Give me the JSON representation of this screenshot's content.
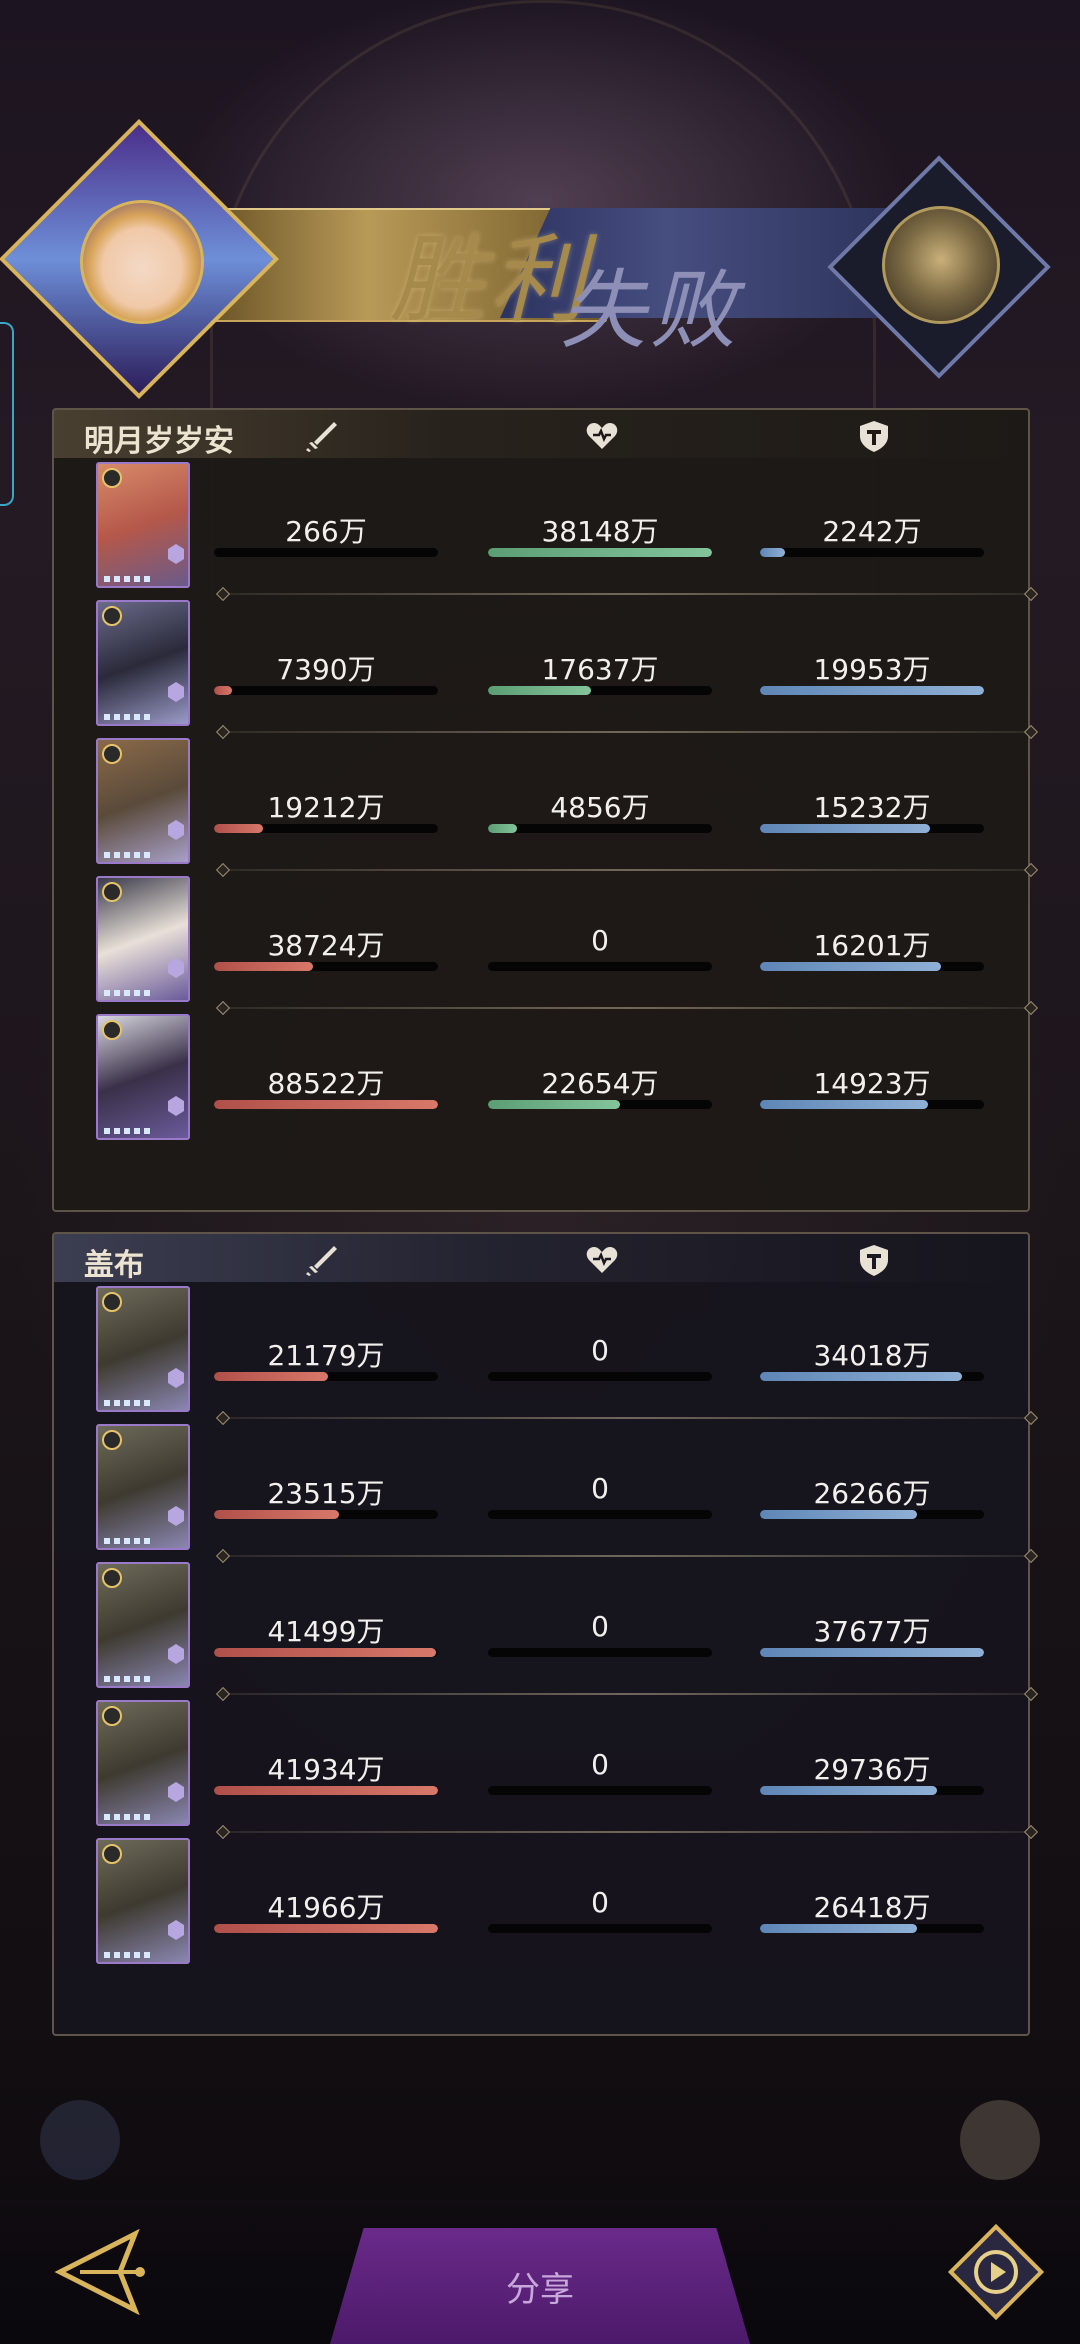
{
  "banner": {
    "victory_label": "胜利",
    "defeat_label": "失败",
    "left_avatar": "chibi-hero-avatar",
    "right_avatar": "armored-knight-avatar"
  },
  "colors": {
    "damage": "#d8786a",
    "healing": "#84c49a",
    "damage_taken": "#8fb0d6",
    "gold_accent": "#d8b45c",
    "defeat_accent": "#464e80"
  },
  "icons": {
    "damage": "sword-icon",
    "healing": "heart-icon",
    "damage_taken": "shield-icon"
  },
  "team_victory": {
    "name": "明月岁岁安",
    "heroes": [
      {
        "damage": "266万",
        "damage_pct": 0.0,
        "heal": "38148万",
        "heal_pct": 1.0,
        "taken": "2242万",
        "taken_pct": 0.11
      },
      {
        "damage": "7390万",
        "damage_pct": 0.08,
        "heal": "17637万",
        "heal_pct": 0.46,
        "taken": "19953万",
        "taken_pct": 1.0
      },
      {
        "damage": "19212万",
        "damage_pct": 0.22,
        "heal": "4856万",
        "heal_pct": 0.13,
        "taken": "15232万",
        "taken_pct": 0.76
      },
      {
        "damage": "38724万",
        "damage_pct": 0.44,
        "heal": "0",
        "heal_pct": 0.0,
        "taken": "16201万",
        "taken_pct": 0.81
      },
      {
        "damage": "88522万",
        "damage_pct": 1.0,
        "heal": "22654万",
        "heal_pct": 0.59,
        "taken": "14923万",
        "taken_pct": 0.75
      }
    ]
  },
  "team_defeat": {
    "name": "盖布",
    "heroes": [
      {
        "damage": "21179万",
        "damage_pct": 0.51,
        "heal": "0",
        "heal_pct": 0.0,
        "taken": "34018万",
        "taken_pct": 0.9
      },
      {
        "damage": "23515万",
        "damage_pct": 0.56,
        "heal": "0",
        "heal_pct": 0.0,
        "taken": "26266万",
        "taken_pct": 0.7
      },
      {
        "damage": "41499万",
        "damage_pct": 0.99,
        "heal": "0",
        "heal_pct": 0.0,
        "taken": "37677万",
        "taken_pct": 1.0
      },
      {
        "damage": "41934万",
        "damage_pct": 1.0,
        "heal": "0",
        "heal_pct": 0.0,
        "taken": "29736万",
        "taken_pct": 0.79
      },
      {
        "damage": "41966万",
        "damage_pct": 1.0,
        "heal": "0",
        "heal_pct": 0.0,
        "taken": "26418万",
        "taken_pct": 0.7
      }
    ]
  },
  "footer": {
    "share_label": "分享",
    "back_icon": "back-arrow-icon",
    "replay_icon": "replay-icon"
  }
}
